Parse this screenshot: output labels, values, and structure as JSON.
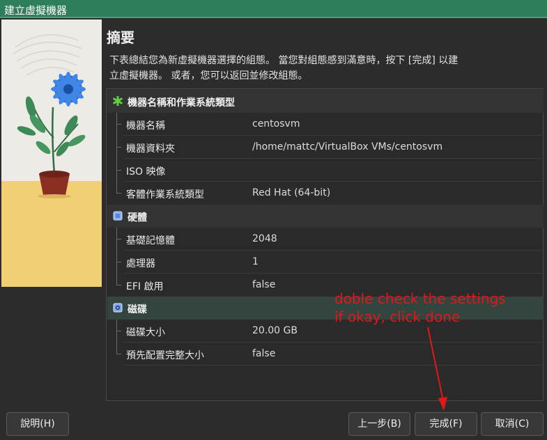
{
  "window": {
    "title": "建立虛擬機器"
  },
  "summary": {
    "heading": "摘要",
    "description_line1": "下表總結您為新虛擬機器選擇的組態。 當您對組態感到滿意時，按下 [完成] 以建",
    "description_line2": "立虛擬機器。 或者，您可以返回並修改組態。"
  },
  "sections": {
    "name_os": {
      "title": "機器名稱和作業系統類型",
      "icon": "green-star-icon",
      "rows": [
        {
          "key": "機器名稱",
          "value": "centosvm"
        },
        {
          "key": "機器資料夾",
          "value": "/home/mattc/VirtualBox VMs/centosvm"
        },
        {
          "key": "ISO 映像",
          "value": ""
        },
        {
          "key": "客體作業系統類型",
          "value": "Red Hat (64-bit)"
        }
      ]
    },
    "hardware": {
      "title": "硬體",
      "icon": "chip-icon",
      "rows": [
        {
          "key": "基礎記憶體",
          "value": "2048"
        },
        {
          "key": "處理器",
          "value": "1"
        },
        {
          "key": "EFI 啟用",
          "value": "false"
        }
      ]
    },
    "disk": {
      "title": "磁碟",
      "icon": "hard-disk-icon",
      "rows": [
        {
          "key": "磁碟大小",
          "value": "20.00 GB"
        },
        {
          "key": "預先配置完整大小",
          "value": "false"
        }
      ]
    }
  },
  "annotation": {
    "line1": "doble check the settings",
    "line2": "if okay, click done",
    "color": "#e01818"
  },
  "buttons": {
    "help": "說明(H)",
    "back": "上一步(B)",
    "done": "完成(F)",
    "cancel": "取消(C)"
  },
  "colors": {
    "titlebar": "#2e7d5b",
    "background": "#2c2c2c",
    "selected_row": "#34453f"
  }
}
